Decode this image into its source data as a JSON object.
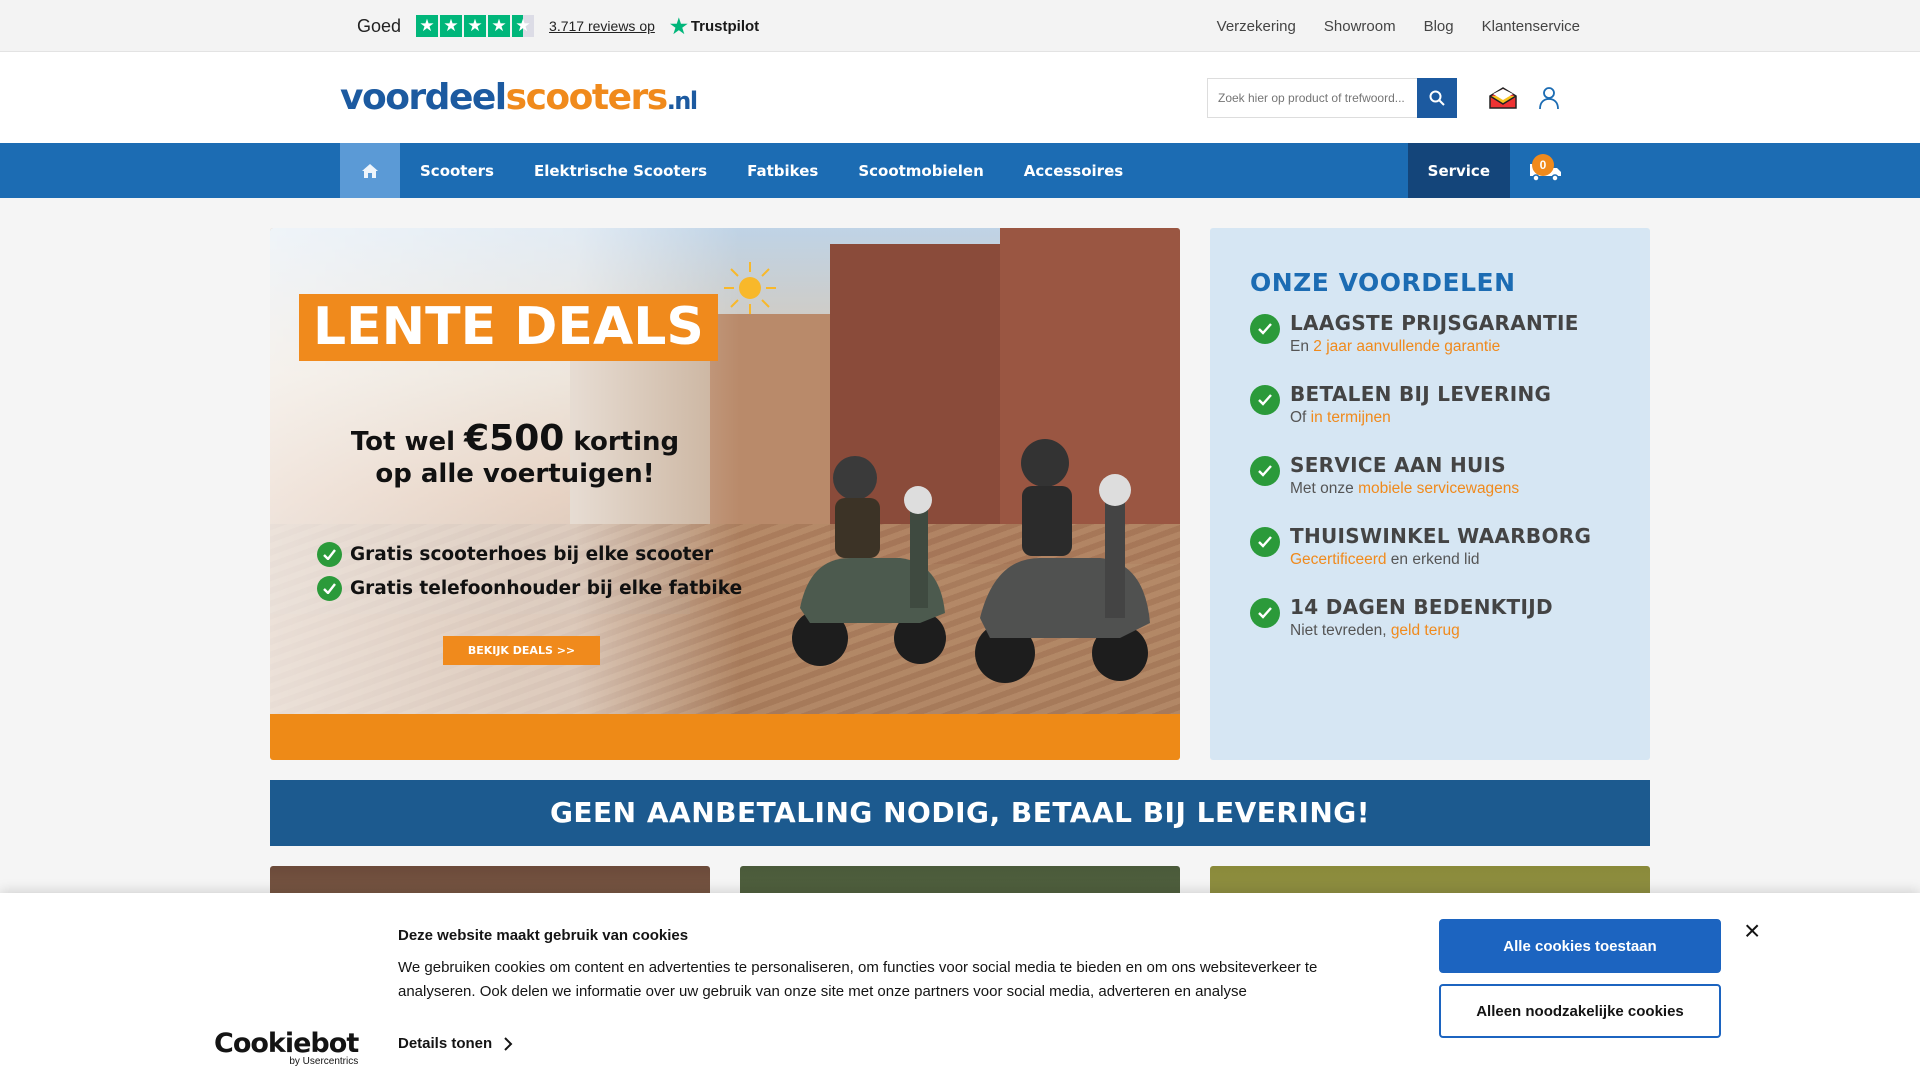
{
  "topbar": {
    "rating_word": "Goed",
    "stars": 4.5,
    "reviews_text": "3.717 reviews op",
    "trustpilot_label": "Trustpilot",
    "links": [
      "Verzekering",
      "Showroom",
      "Blog",
      "Klantenservice"
    ]
  },
  "header": {
    "logo_part1": "voordeel",
    "logo_part2": "scooters",
    "logo_part3": ".nl",
    "search_placeholder": "Zoek hier op product of trefwoord..."
  },
  "nav": {
    "items": [
      "Scooters",
      "Elektrische Scooters",
      "Fatbikes",
      "Scootmobielen",
      "Accessoires"
    ],
    "service_label": "Service",
    "cart_count": "0"
  },
  "banner": {
    "headline": "LENTE DEALS",
    "korting_line1_pre": "Tot wel ",
    "korting_amount": "€500",
    "korting_line1_post": " korting",
    "korting_line2": "op alle voertuigen!",
    "perks": [
      "Gratis scooterhoes bij elke scooter",
      "Gratis telefoonhouder bij elke fatbike"
    ],
    "button_label": "BEKIJK DEALS >>"
  },
  "voordelen": {
    "title": "ONZE VOORDELEN",
    "items": [
      {
        "head": "LAAGSTE PRIJSGARANTIE",
        "pre": "En ",
        "highlight": "2 jaar aanvullende garantie",
        "post": ""
      },
      {
        "head": "BETALEN BIJ LEVERING",
        "pre": "Of ",
        "highlight": "in termijnen",
        "post": ""
      },
      {
        "head": "SERVICE AAN HUIS",
        "pre": "Met onze ",
        "highlight": "mobiele servicewagens",
        "post": ""
      },
      {
        "head": "THUISWINKEL WAARBORG",
        "pre": "",
        "highlight": "Gecertificeerd",
        "post": " en erkend lid"
      },
      {
        "head": "14 DAGEN BEDENKTIJD",
        "pre": "Niet tevreden, ",
        "highlight": "geld terug",
        "post": ""
      }
    ]
  },
  "strip": {
    "text": "GEEN AANBETALING NODIG, BETAAL BIJ LEVERING!"
  },
  "cookie": {
    "logo_main": "Cookiebot",
    "logo_sub": "by Usercentrics",
    "title": "Deze website maakt gebruik van cookies",
    "text": "We gebruiken cookies om content en advertenties te personaliseren, om functies voor social media te bieden en om ons websiteverkeer te analyseren. Ook delen we informatie over uw gebruik van onze site met onze partners voor social media, adverteren en analyse",
    "details_label": "Details tonen",
    "allow_all_label": "Alle cookies toestaan",
    "necessary_label": "Alleen noodzakelijke cookies",
    "close_symbol": "×"
  },
  "colors": {
    "brand_blue": "#1c6cb3",
    "brand_orange": "#f08a1c",
    "check_green": "#2b9a3a",
    "strip_blue": "#1c5a8f"
  }
}
